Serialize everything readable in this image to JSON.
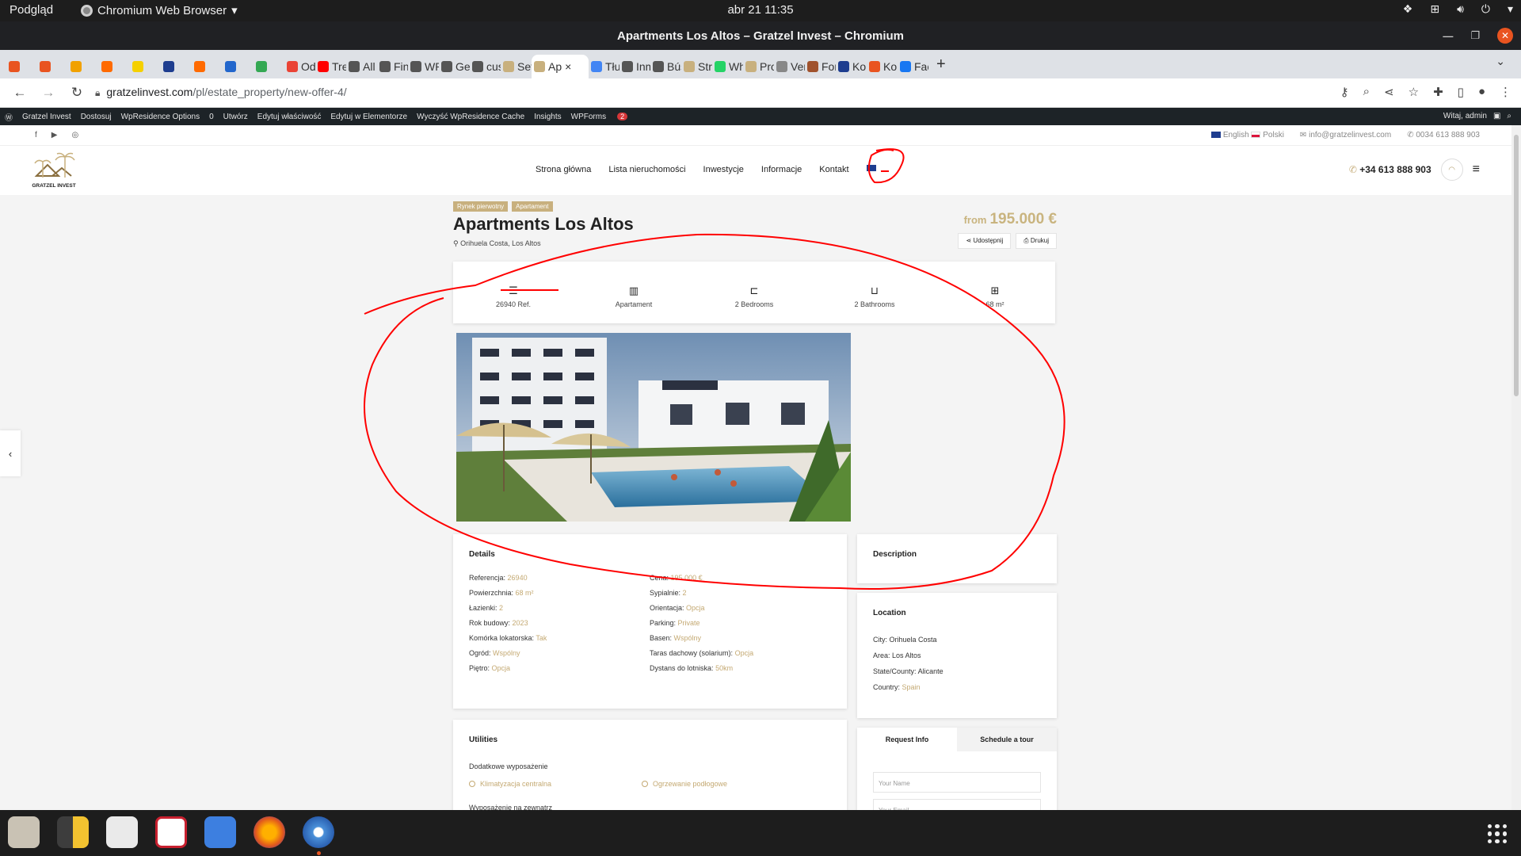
{
  "gnome": {
    "activities": "Podgląd",
    "app_name": "Chromium Web Browser",
    "clock": "abr 21  11:35"
  },
  "window": {
    "title": "Apartments Los Altos – Gratzel Invest – Chromium"
  },
  "tabs": [
    {
      "label": "",
      "color": "#e95420"
    },
    {
      "label": "",
      "color": "#e95420"
    },
    {
      "label": "",
      "color": "#f1a100"
    },
    {
      "label": "",
      "color": "#ff6a00"
    },
    {
      "label": "",
      "color": "#f5d000"
    },
    {
      "label": "",
      "color": "#1e3d8f"
    },
    {
      "label": "",
      "color": "#ff6a00"
    },
    {
      "label": "",
      "color": "#2266cc"
    },
    {
      "label": "",
      "color": "#34a853"
    },
    {
      "label": "Ode",
      "color": "#ea4335"
    },
    {
      "label": "Treś",
      "color": "#ff0000"
    },
    {
      "label": "All T",
      "color": "#555555"
    },
    {
      "label": "Find",
      "color": "#555555"
    },
    {
      "label": "WP F",
      "color": "#555555"
    },
    {
      "label": "Gett",
      "color": "#555555"
    },
    {
      "label": "cust",
      "color": "#555555"
    },
    {
      "label": "Setti",
      "color": "#c8b07e"
    },
    {
      "label": "Ap",
      "color": "#c8b07e",
      "active": true
    },
    {
      "label": "Tłum",
      "color": "#4285f4"
    },
    {
      "label": "Inmc",
      "color": "#555555"
    },
    {
      "label": "Búsc",
      "color": "#555555"
    },
    {
      "label": "Stro",
      "color": "#c8b07e"
    },
    {
      "label": "Wha",
      "color": "#25d366"
    },
    {
      "label": "Prop",
      "color": "#c8b07e"
    },
    {
      "label": "Vent",
      "color": "#888888"
    },
    {
      "label": "For s",
      "color": "#a0522d"
    },
    {
      "label": "Kont",
      "color": "#1e3d8f"
    },
    {
      "label": "Kont",
      "color": "#e95420"
    },
    {
      "label": "Face",
      "color": "#1877f2"
    }
  ],
  "address": {
    "host": "gratzelinvest.com",
    "path": "/pl/estate_property/new-offer-4/"
  },
  "wpbar": {
    "items": [
      "Gratzel Invest",
      "Dostosuj",
      "WpResidence Options",
      "0",
      "Utwórz",
      "Edytuj właściwość",
      "Edytuj w Elementorze",
      "Wyczyść WpResidence Cache",
      "Insights",
      "WPForms"
    ],
    "wpforms_badge": "2",
    "greeting": "Witaj, admin"
  },
  "topline": {
    "lang_en": "English",
    "lang_pl": "Polski",
    "email": "info@gratzelinvest.com",
    "phone": "0034 613 888 903"
  },
  "nav": {
    "items": [
      "Strona główna",
      "Lista nieruchomości",
      "Inwestycje",
      "Informacje",
      "Kontakt"
    ],
    "phone": "+34 613 888 903"
  },
  "logo": {
    "text": "GRATZEL INVEST"
  },
  "property": {
    "tags": [
      "Rynek pierwotny",
      "Apartament"
    ],
    "title": "Apartments Los Altos",
    "address": "Orihuela Costa, Los Altos",
    "price_prefix": "from",
    "price": "195.000 €",
    "share_label": "Udostępnij",
    "print_label": "Drukuj",
    "features": [
      "26940 Ref.",
      "Apartament",
      "2 Bedrooms",
      "2 Bathrooms",
      "68 m²"
    ]
  },
  "details": {
    "title": "Details",
    "left": [
      {
        "k": "Referencja:",
        "v": "26940"
      },
      {
        "k": "Powierzchnia:",
        "v": "68 m²"
      },
      {
        "k": "Łazienki:",
        "v": "2"
      },
      {
        "k": "Rok budowy:",
        "v": "2023"
      },
      {
        "k": "Komórka lokatorska:",
        "v": "Tak"
      },
      {
        "k": "Ogród:",
        "v": "Wspólny"
      },
      {
        "k": "Piętro:",
        "v": "Opcja"
      }
    ],
    "right": [
      {
        "k": "Cena:",
        "v": "195.000 €"
      },
      {
        "k": "Sypialnie:",
        "v": "2"
      },
      {
        "k": "Orientacja:",
        "v": "Opcja"
      },
      {
        "k": "Parking:",
        "v": "Private"
      },
      {
        "k": "Basen:",
        "v": "Wspólny"
      },
      {
        "k": "Taras dachowy (solarium):",
        "v": "Opcja"
      },
      {
        "k": "Dystans do lotniska:",
        "v": "50km"
      }
    ]
  },
  "description": {
    "title": "Description"
  },
  "location": {
    "title": "Location",
    "rows": [
      {
        "k": "City:",
        "v": "Orihuela Costa"
      },
      {
        "k": "Area:",
        "v": "Los Altos"
      },
      {
        "k": "State/County:",
        "v": "Alicante"
      },
      {
        "k": "Country:",
        "v": "Spain"
      }
    ]
  },
  "utilities": {
    "title": "Utilities",
    "sub1": "Dodatkowe wyposażenie",
    "item1": "Klimatyzacja centralna",
    "item2": "Ogrzewanie podłogowe",
    "sub2": "Wyposażenie na zewnątrz"
  },
  "request": {
    "tab1": "Request Info",
    "tab2": "Schedule a tour",
    "name_placeholder": "Your Name",
    "email_placeholder": "Your Email"
  },
  "colors": {
    "accent": "#c8b07e",
    "annotation": "#ff0000"
  }
}
